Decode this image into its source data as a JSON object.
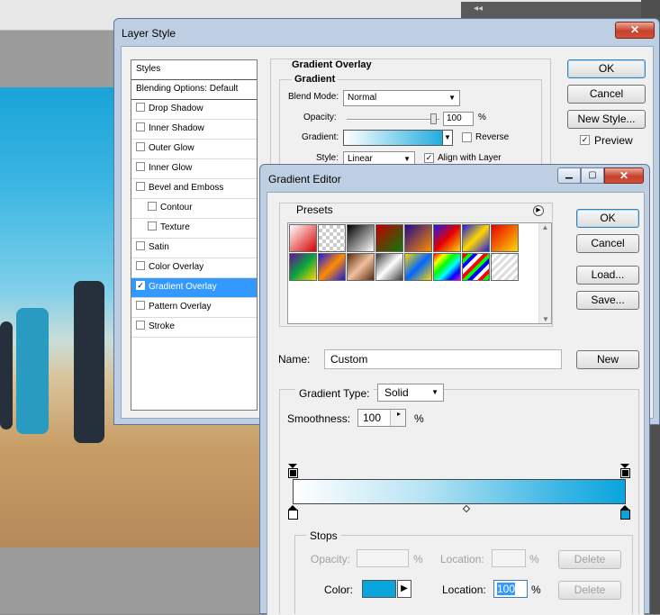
{
  "layer_style": {
    "title": "Layer Style",
    "close": "✕",
    "styles_list": [
      {
        "label": "Styles",
        "type": "header"
      },
      {
        "label": "Blending Options: Default",
        "type": "header"
      },
      {
        "label": "Drop Shadow",
        "checked": false
      },
      {
        "label": "Inner Shadow",
        "checked": false
      },
      {
        "label": "Outer Glow",
        "checked": false
      },
      {
        "label": "Inner Glow",
        "checked": false
      },
      {
        "label": "Bevel and Emboss",
        "checked": false
      },
      {
        "label": "Contour",
        "checked": false,
        "indent": true
      },
      {
        "label": "Texture",
        "checked": false,
        "indent": true
      },
      {
        "label": "Satin",
        "checked": false
      },
      {
        "label": "Color Overlay",
        "checked": false
      },
      {
        "label": "Gradient Overlay",
        "checked": true,
        "selected": true
      },
      {
        "label": "Pattern Overlay",
        "checked": false
      },
      {
        "label": "Stroke",
        "checked": false
      }
    ],
    "section_title": "Gradient Overlay",
    "subsection_title": "Gradient",
    "blend_mode_label": "Blend Mode:",
    "blend_mode_value": "Normal",
    "opacity_label": "Opacity:",
    "opacity_value": "100",
    "opacity_unit": "%",
    "gradient_label": "Gradient:",
    "reverse_label": "Reverse",
    "style_label": "Style:",
    "style_value": "Linear",
    "align_label": "Align with Layer",
    "buttons": {
      "ok": "OK",
      "cancel": "Cancel",
      "new_style": "New Style...",
      "preview": "Preview"
    },
    "check_mark": "✓"
  },
  "gradient_editor": {
    "title": "Gradient Editor",
    "presets_label": "Presets",
    "presets_menu_icon": "▶",
    "preset_gradients": [
      "linear-gradient(135deg,#ffffff,#d80000)",
      "repeating-conic-gradient(#ccc 0 25%, #fff 0 50%) 0 0/8px 8px",
      "linear-gradient(135deg,#000,#fff)",
      "linear-gradient(135deg,#c00000,#0a7a0a)",
      "linear-gradient(135deg,#200a8a,#ff8c00)",
      "linear-gradient(135deg,#1a1ae6,#e60000,#ffd700)",
      "linear-gradient(135deg,#1a1ae6,#ffd700,#1a1ae6)",
      "linear-gradient(135deg,#e60000,#ffd700)",
      "linear-gradient(135deg,#6a0aa0,#0aa53c,#ffd700)",
      "linear-gradient(135deg,#1a1ae6,#ff8c00,#1a1ae6)",
      "linear-gradient(135deg,#5a2a10,#f0c0a0,#5a2a10)",
      "linear-gradient(135deg,#3a3a3a,#fff,#3a3a3a)",
      "linear-gradient(135deg,#ffd700,#0066ff,#ffd700)",
      "linear-gradient(135deg,#ff0000,#ffff00,#00ff00,#00ffff,#0000ff,#ff00ff)",
      "repeating-linear-gradient(135deg,#ff0000 0 4px,#00ff00 4px 8px,#0000ff 8px 12px,#fff 12px 16px)",
      "repeating-linear-gradient(135deg,#ddd 0 3px,#fff 3px 6px)"
    ],
    "name_label": "Name:",
    "name_value": "Custom",
    "buttons": {
      "ok": "OK",
      "cancel": "Cancel",
      "load": "Load...",
      "save": "Save...",
      "new": "New",
      "delete_opacity": "Delete",
      "delete_color": "Delete"
    },
    "gradient_type_label": "Gradient Type:",
    "gradient_type_value": "Solid",
    "smoothness_label": "Smoothness:",
    "smoothness_value": "100",
    "smoothness_unit": "%",
    "stops_label": "Stops",
    "stop_opacity_label": "Opacity:",
    "stop_opacity_unit": "%",
    "stop_opacity_location_label": "Location:",
    "stop_opacity_location_unit": "%",
    "color_label": "Color:",
    "color_location_label": "Location:",
    "color_location_value": "100",
    "color_location_unit": "%",
    "stop_color": "#0aa5dd",
    "gradient_start_color": "#ffffff",
    "gradient_end_color": "#0aa5dd",
    "color_midpoint_location": 50
  }
}
